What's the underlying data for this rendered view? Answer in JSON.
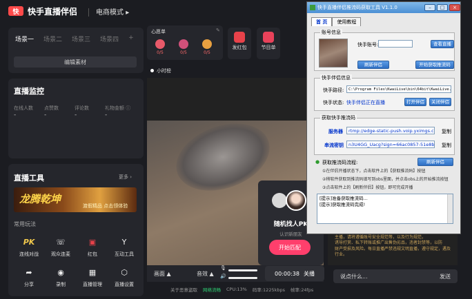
{
  "app": {
    "logo": "快",
    "title": "快手直播伴侣",
    "mode": "电商模式"
  },
  "scenes": {
    "tabs": [
      "场景一",
      "场景二",
      "场景三",
      "场景四"
    ],
    "add": "+",
    "edit_label": "编辑素材"
  },
  "wish": {
    "title": "心愿单",
    "gifts": [
      {
        "count": "0/5",
        "color": "#e85a6a"
      },
      {
        "count": "0/5",
        "color": "#d0507a"
      },
      {
        "count": "0/5",
        "color": "#e8a040"
      }
    ]
  },
  "quick": [
    {
      "label": "发红包",
      "color": "#e8424a"
    },
    {
      "label": "节目单",
      "color": "#e8425a"
    }
  ],
  "small_window": {
    "label": "小时榜"
  },
  "monitor": {
    "title": "直播监控",
    "stats": [
      {
        "label": "在线人数",
        "value": "-"
      },
      {
        "label": "点赞数",
        "value": "-"
      },
      {
        "label": "评论数",
        "value": "-"
      },
      {
        "label": "礼物金额",
        "value": "-"
      }
    ]
  },
  "tools": {
    "title": "直播工具",
    "more": "更多",
    "banner_text": "龙腾乾坤",
    "banner_sub": "渡假精品 点击领体验",
    "section": "常用玩法",
    "items": [
      {
        "label": "连线对战",
        "icon": "PK"
      },
      {
        "label": "观众连麦",
        "icon": "☏"
      },
      {
        "label": "红包",
        "icon": "▣"
      },
      {
        "label": "互动工具",
        "icon": "Y"
      },
      {
        "label": "分享",
        "icon": "➦"
      },
      {
        "label": "录制",
        "icon": "◉"
      },
      {
        "label": "直播管理",
        "icon": "▦"
      },
      {
        "label": "直播设置",
        "icon": "⬡"
      }
    ]
  },
  "pk": {
    "title": "随机找人PK",
    "sub": "认识新朋友",
    "button": "开始匹配"
  },
  "controls": {
    "picture": "画面",
    "audio": "音效",
    "timer": "00:00:38",
    "close_live": "关播"
  },
  "status": {
    "about": "关于恶意盗取",
    "network_label": "网络流畅",
    "cpu": "CPU:13%",
    "bitrate": "码率:1225kbps",
    "fps": "帧率:24fps"
  },
  "chat": {
    "messages": [
      "主播，请将遵循账号安全规范等，以及行为规范，",
      "诱导打赏、私下转账或推广出售伪劣品，违者封禁等，以防",
      "财产受损及风险。每日直播严禁违规文明直播，遵守规定，遇及",
      "行业。"
    ],
    "input_placeholder": "说点什么...",
    "send": "发送"
  },
  "tool_window": {
    "title": "快手直播伴侣推流码获取工具 V1.1.0",
    "tabs": [
      "首 页",
      "使用教程"
    ],
    "account": {
      "group": "账号信息",
      "account_label": "快手账号:",
      "account_value": "",
      "view_btn": "查看直播",
      "refresh_btn": "刷新伴侣",
      "get_btn": "开始获取推流码"
    },
    "companion": {
      "group": "快手伴侣信息",
      "path_label": "快手路径:",
      "path_value": "C:\\Program Files\\KwaiLive\\bin\\64bit\\KwaiLive.exe",
      "status_label": "快手状态:",
      "status_value": "快手伴侣正在直播",
      "open_btn": "打开伴侣",
      "close_btn": "关闭伴侣"
    },
    "stream": {
      "group": "获取快手推流码",
      "server_label": "服务器",
      "server_value": "rtmp://edge-static-push.voip.yximgs.c",
      "key_label": "串流密钥",
      "key_value": "n3U4GG_Uacg?sign=66ac0857-51e8b",
      "copy": "复制"
    },
    "steps": {
      "title": "获取推流码流程:",
      "refresh_btn": "刷新伴侣",
      "lines": [
        "①在伴侣开播状态下，点击软件上的【获取推流码】按钮",
        "②稍软件获取到推流码填写到obs里面，并点击obs上的开始推流按钮",
        "③点击软件上的【刷新伴侣】按钮，即可完成开播"
      ]
    },
    "log": [
      "[提示]准备获取推流码...",
      "[提示]获取推流码完成!"
    ]
  }
}
